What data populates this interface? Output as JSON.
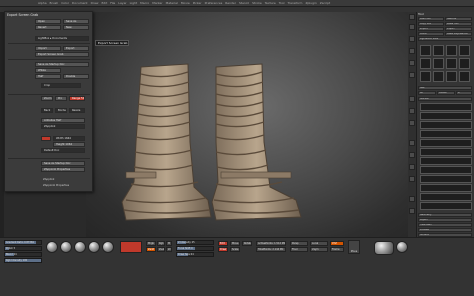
{
  "menu": [
    "Alpha",
    "Brush",
    "Color",
    "Document",
    "Draw",
    "Edit",
    "File",
    "Layer",
    "Light",
    "Macro",
    "Marker",
    "Material",
    "Movie",
    "Picker",
    "Preferences",
    "Render",
    "Stencil",
    "Stroke",
    "Texture",
    "Tool",
    "Transform",
    "Zplugin",
    "Zscript"
  ],
  "popup": {
    "title": "Export Screen Grab",
    "buttons": {
      "open": "Open",
      "save": "Save As",
      "revert": "Revert",
      "new": "New",
      "lightbox": "LightBox ▸ Documents",
      "import": "Import",
      "export": "Export",
      "export_grab": "Export Screen Grab",
      "save_startup": "Save As Startup Doc",
      "wsize": "WSize",
      "halfsize": "Half",
      "double": "Double",
      "crop": "Crop",
      "zoom": "Zoom",
      "range": "Range 50",
      "pro": "Pro",
      "antialias": "Antialias Half",
      "width": "Width 1664",
      "height": "Height 1064",
      "resize": "Resize",
      "border": "Border 0",
      "back": "Back",
      "save_as_base": "Save As Startup Doc",
      "default_doc": "Default Doc",
      "zapplink": "ZApplink",
      "zapplink_properties": "ZAppLink Properties"
    }
  },
  "tooltip": "Export Screen Grab",
  "right_panel": {
    "title": "Tool",
    "buttons": [
      "Load Tool",
      "Save As",
      "Copy Tool",
      "Paste Tool",
      "Import",
      "Export",
      "Clone",
      "Make PolyMesh3D",
      "GoZ",
      "All",
      "Visible",
      "R",
      "Lightbox ▸ Tools"
    ],
    "sections": [
      "SubTool",
      "Geometry",
      "Layers",
      "FiberMesh",
      "Preview",
      "Surface",
      "Deformation",
      "Masking",
      "Visibility",
      "Polygroups",
      "Contact",
      "Morph Target",
      "Polypaint",
      "UV Map",
      "Texture Map",
      "Displacement Map",
      "Normal Map",
      "Vector Displacement Map",
      "Display Properties",
      "Unified Skin",
      "Initialize",
      "Import",
      "Export"
    ]
  },
  "bottom": {
    "sliders": [
      "Gradient Ratio 0.87369",
      "Polish 5",
      "Blend 24",
      "Rgb Intensity 100",
      "Z Intensity 25",
      "Focal Shift 0",
      "Draw Size 64",
      "Dynamic"
    ],
    "labels": [
      "Mrgb",
      "Rgb",
      "M",
      "Zadd",
      "Zsub",
      "Zcut",
      "Edit",
      "Draw",
      "Move",
      "Scale",
      "Rotate",
      "Brush",
      "Stroke",
      "Alpha",
      "Texture",
      "Material",
      "Points",
      "Polys",
      "ActivePoints",
      "TotalPoints"
    ],
    "stats": [
      "ActivePoints: 1.512 Mil",
      "TotalPoints: 2.144 Mil"
    ],
    "buttons": [
      "Persp",
      "Floor",
      "Local",
      "LSym",
      "XYZ",
      "Frame",
      "Move",
      "Scale",
      "Rotate",
      "PolyF",
      "Transp",
      "Ghost",
      "Solo",
      "Xpose"
    ]
  },
  "colors": {
    "accent": "#c0392b",
    "orange": "#d35400",
    "slider_fill": "#5d6f88",
    "panel": "#3b3b3b",
    "background": "#2a2a2a"
  }
}
